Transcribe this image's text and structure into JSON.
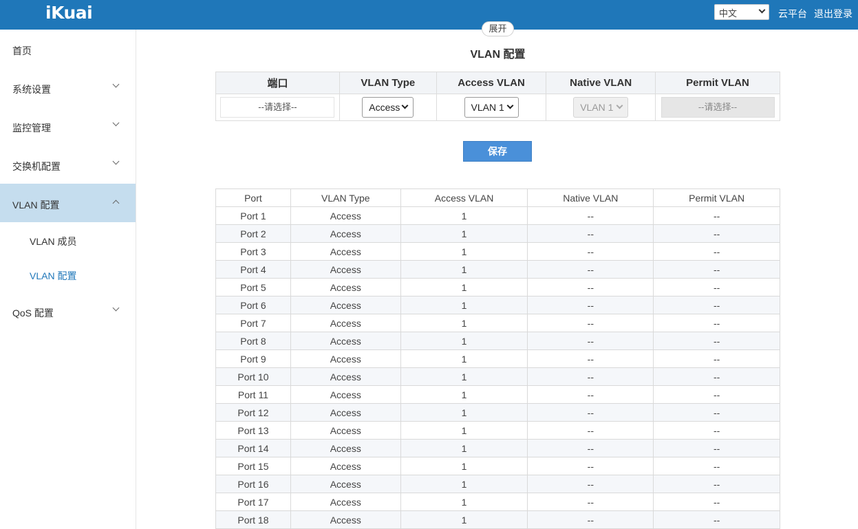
{
  "header": {
    "logo": "iKuai",
    "language": "中文",
    "cloud_link": "云平台",
    "logout_link": "退出登录"
  },
  "sidebar": {
    "items": [
      {
        "label": "首页"
      },
      {
        "label": "系统设置"
      },
      {
        "label": "监控管理"
      },
      {
        "label": "交换机配置"
      },
      {
        "label": "VLAN 配置"
      },
      {
        "label": "QoS 配置"
      }
    ],
    "sub_items": [
      {
        "label": "VLAN 成员"
      },
      {
        "label": "VLAN 配置"
      }
    ]
  },
  "expand_label": "展开",
  "page_title": "VLAN 配置",
  "config": {
    "headers": [
      "端口",
      "VLAN Type",
      "Access VLAN",
      "Native VLAN",
      "Permit VLAN"
    ],
    "port_placeholder": "--请选择--",
    "vlan_type": "Access",
    "access_vlan": "VLAN 1",
    "native_vlan": "VLAN 1",
    "permit_placeholder": "--请选择--"
  },
  "save_label": "保存",
  "table": {
    "headers": [
      "Port",
      "VLAN Type",
      "Access VLAN",
      "Native VLAN",
      "Permit VLAN"
    ],
    "rows": [
      [
        "Port 1",
        "Access",
        "1",
        "--",
        "--"
      ],
      [
        "Port 2",
        "Access",
        "1",
        "--",
        "--"
      ],
      [
        "Port 3",
        "Access",
        "1",
        "--",
        "--"
      ],
      [
        "Port 4",
        "Access",
        "1",
        "--",
        "--"
      ],
      [
        "Port 5",
        "Access",
        "1",
        "--",
        "--"
      ],
      [
        "Port 6",
        "Access",
        "1",
        "--",
        "--"
      ],
      [
        "Port 7",
        "Access",
        "1",
        "--",
        "--"
      ],
      [
        "Port 8",
        "Access",
        "1",
        "--",
        "--"
      ],
      [
        "Port 9",
        "Access",
        "1",
        "--",
        "--"
      ],
      [
        "Port 10",
        "Access",
        "1",
        "--",
        "--"
      ],
      [
        "Port 11",
        "Access",
        "1",
        "--",
        "--"
      ],
      [
        "Port 12",
        "Access",
        "1",
        "--",
        "--"
      ],
      [
        "Port 13",
        "Access",
        "1",
        "--",
        "--"
      ],
      [
        "Port 14",
        "Access",
        "1",
        "--",
        "--"
      ],
      [
        "Port 15",
        "Access",
        "1",
        "--",
        "--"
      ],
      [
        "Port 16",
        "Access",
        "1",
        "--",
        "--"
      ],
      [
        "Port 17",
        "Access",
        "1",
        "--",
        "--"
      ],
      [
        "Port 18",
        "Access",
        "1",
        "--",
        "--"
      ]
    ]
  }
}
